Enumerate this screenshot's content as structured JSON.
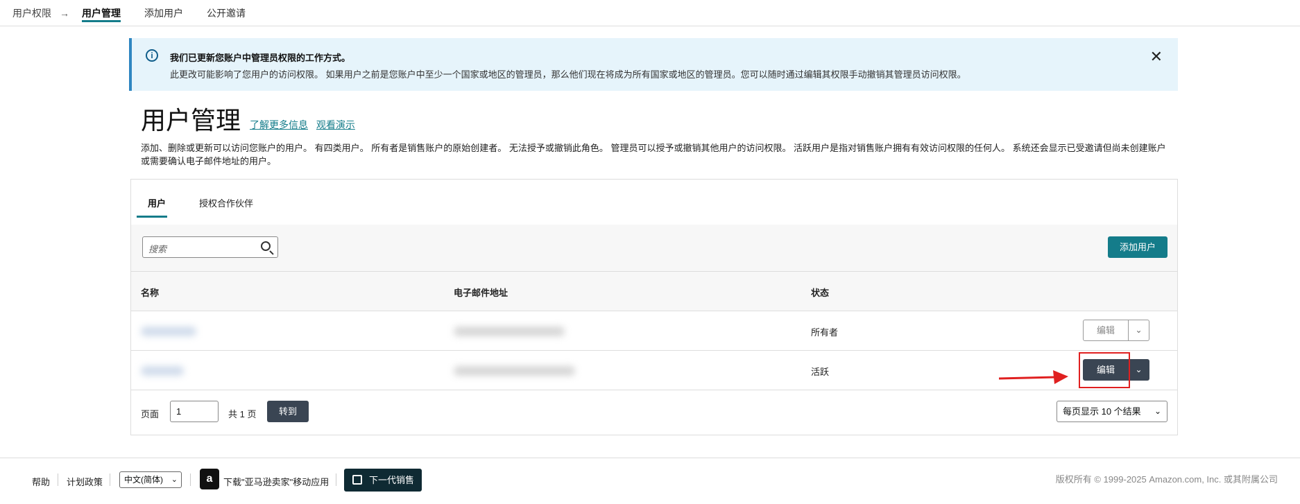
{
  "topnav": {
    "breadcrumb": "用户权限",
    "tabs": [
      "用户管理",
      "添加用户",
      "公开邀请"
    ],
    "active_tab": "用户管理"
  },
  "banner": {
    "title": "我们已更新您账户中管理员权限的工作方式。",
    "text": "此更改可能影响了您用户的访问权限。 如果用户之前是您账户中至少一个国家或地区的管理员，那么他们现在将成为所有国家或地区的管理员。您可以随时通过编辑其权限手动撤销其管理员访问权限。"
  },
  "page": {
    "title": "用户管理",
    "learn_more": "了解更多信息",
    "watch_demo": "观看演示",
    "description": "添加、删除或更新可以访问您账户的用户。 有四类用户。 所有者是销售账户的原始创建者。 无法授予或撤销此角色。 管理员可以授予或撤销其他用户的访问权限。 活跃用户是指对销售账户拥有有效访问权限的任何人。 系统还会显示已受邀请但尚未创建账户或需要确认电子邮件地址的用户。"
  },
  "panel": {
    "tabs": [
      "用户",
      "授权合作伙伴"
    ],
    "search_placeholder": "搜索",
    "add_user": "添加用户",
    "columns": [
      "名称",
      "电子邮件地址",
      "状态"
    ],
    "rows": [
      {
        "status": "所有者",
        "edit": "编辑"
      },
      {
        "status": "活跃",
        "edit": "编辑"
      }
    ],
    "pager": {
      "label": "页面",
      "current": "1",
      "total": "共 1 页",
      "go": "转到",
      "per_page": "每页显示 10 个结果"
    }
  },
  "footer": {
    "help": "帮助",
    "policy": "计划政策",
    "language": "中文(简体)",
    "app_download": "下载\"亚马逊卖家\"移动应用",
    "next_gen": "下一代销售",
    "copyright": "版权所有 © 1999-2025 Amazon.com, Inc. 或其附属公司"
  },
  "colors": {
    "accent": "#147c8a",
    "dark_button": "#3a4553",
    "banner_bg": "#e6f4fb",
    "highlight": "#e02020"
  }
}
